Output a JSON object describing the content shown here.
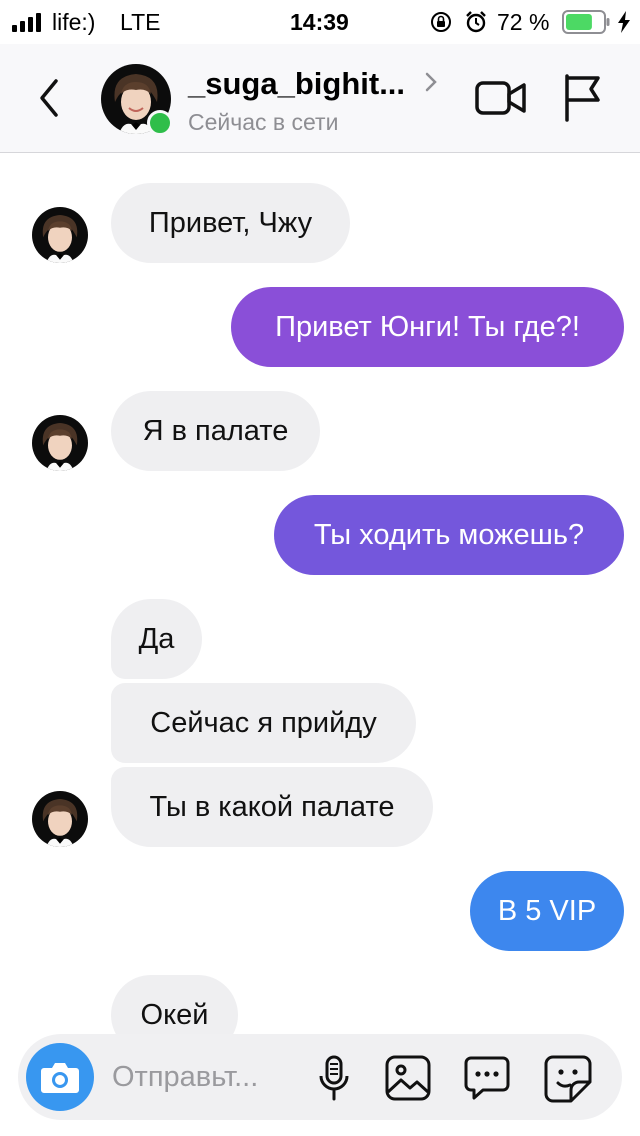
{
  "status_bar": {
    "carrier": "life:)",
    "network": "LTE",
    "time": "14:39",
    "battery_percent": "72 %",
    "battery_level": 0.72
  },
  "header": {
    "username": "_suga_bighit...",
    "status": "Сейчас в сети"
  },
  "messages": [
    {
      "text": "Привет, Чжу",
      "from": "them"
    },
    {
      "text": "Привет Юнги! Ты где?!",
      "from": "me"
    },
    {
      "text": "Я в палате",
      "from": "them"
    },
    {
      "text": "Ты ходить можешь?",
      "from": "me"
    },
    {
      "text": "Да",
      "from": "them"
    },
    {
      "text": "Сейчас я прийду",
      "from": "them"
    },
    {
      "text": "Ты в какой палате",
      "from": "them"
    },
    {
      "text": "В 5 VIP",
      "from": "me"
    },
    {
      "text": "Окей",
      "from": "them"
    }
  ],
  "composer": {
    "placeholder": "Отправьт..."
  },
  "colors": {
    "accent": "#3897f0",
    "online": "#2fbe4a",
    "incoming_bubble": "#efeff1",
    "outgoing_purple": "#8a4fd8",
    "outgoing_blue": "#3d87ee"
  },
  "icons": [
    "signal-icon",
    "lock-rotation-icon",
    "alarm-icon",
    "battery-icon",
    "charging-icon",
    "back-icon",
    "video-call-icon",
    "flag-icon",
    "camera-icon",
    "microphone-icon",
    "gallery-icon",
    "chat-bubble-icon",
    "sticker-icon"
  ]
}
